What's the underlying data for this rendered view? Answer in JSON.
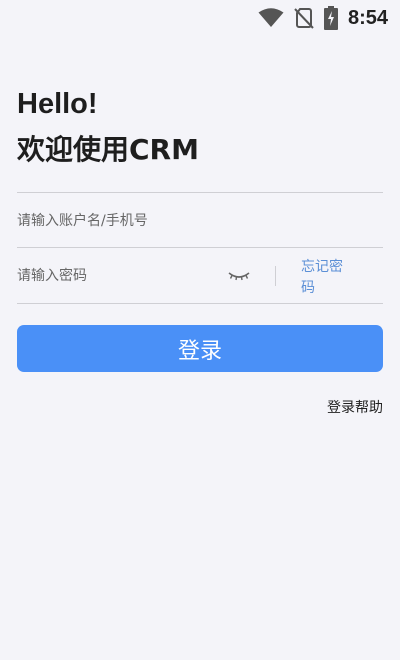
{
  "status_bar": {
    "time": "8:54",
    "icons": [
      "wifi-icon",
      "no-sim-icon",
      "battery-charging-icon"
    ]
  },
  "header": {
    "greeting": "Hello!",
    "welcome": "欢迎使用CRM"
  },
  "form": {
    "account_placeholder": "请输入账户名/手机号",
    "account_value": "",
    "password_placeholder": "请输入密码",
    "password_value": "",
    "forgot_label": "忘记密码",
    "login_label": "登录",
    "help_label": "登录帮助"
  },
  "colors": {
    "background": "#f4f4f9",
    "primary": "#4a90f7",
    "link": "#5b8fd6"
  }
}
